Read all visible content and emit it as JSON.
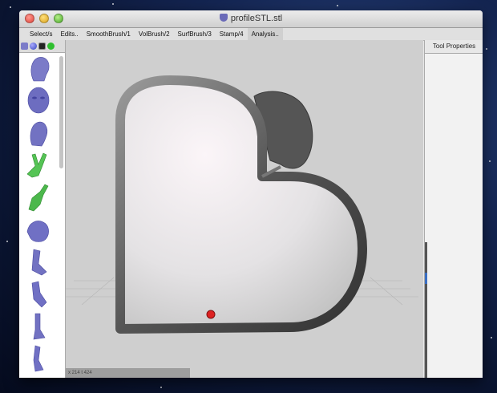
{
  "window": {
    "title": "profileSTL.stl"
  },
  "menubar": {
    "items": [
      "Select/s",
      "Edits..",
      "SmoothBrush/1",
      "VolBrush/2",
      "SurfBrush/3",
      "Stamp/4",
      "Analysis.."
    ]
  },
  "left_panel": {
    "tabs": [
      "brush-icon",
      "sphere-icon",
      "square-icon",
      "gem-icon"
    ],
    "thumbnails": [
      {
        "name": "head-profile",
        "color": "#7b7bc8"
      },
      {
        "name": "face-front",
        "color": "#7b7bc8"
      },
      {
        "name": "head-side",
        "color": "#7b7bc8"
      },
      {
        "name": "hand-peace",
        "color": "#55c455"
      },
      {
        "name": "hand-point",
        "color": "#55c455"
      },
      {
        "name": "torso",
        "color": "#7b7bc8"
      },
      {
        "name": "leg",
        "color": "#7b7bc8"
      },
      {
        "name": "arm",
        "color": "#7b7bc8"
      },
      {
        "name": "foot",
        "color": "#7b7bc8"
      },
      {
        "name": "figure",
        "color": "#7b7bc8"
      }
    ]
  },
  "viewport": {
    "status": "x 214 t 424",
    "background": "#cfcfcf",
    "marker_color": "#dd2222"
  },
  "right_panel": {
    "header": "Tool Properties"
  }
}
